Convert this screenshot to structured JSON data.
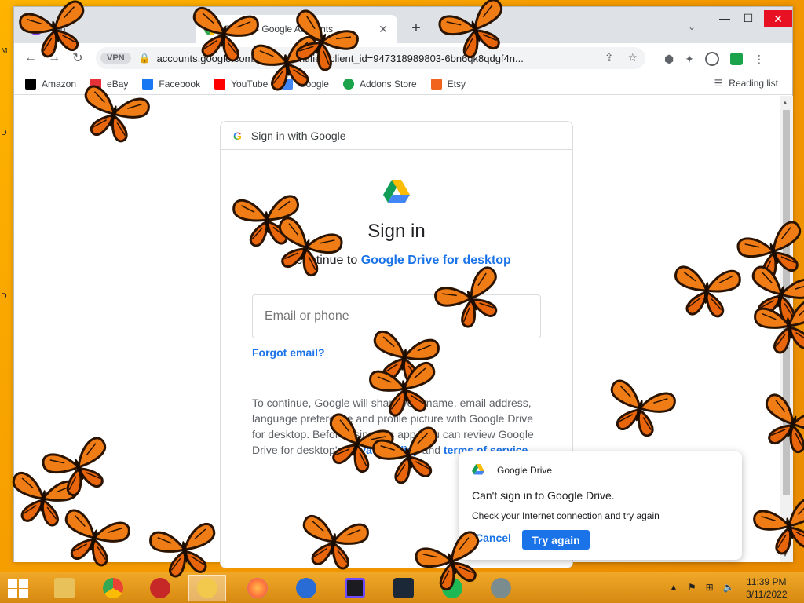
{
  "desktop": {
    "edge_labels": [
      "M",
      "D",
      "D"
    ]
  },
  "browser": {
    "tabs": [
      {
        "title": "Tab",
        "icon": "opera-icon"
      },
      {
        "title": "Sign in - Google Accounts",
        "icon": "google-icon"
      }
    ],
    "new_tab_label": "+",
    "tab_search_label": "⌄",
    "window_controls": {
      "minimize": "—",
      "maximize": "☐",
      "close": "✕"
    },
    "toolbar": {
      "back": "←",
      "forward": "→",
      "reload": "↻",
      "vpn_badge": "VPN",
      "url": "accounts.google.com/signin/identifier?client_id=947318989803-6bn6qk8qdgf4n..."
    },
    "bookmarks": [
      {
        "label": "Amazon",
        "icon": "amazon-icon",
        "color": "#000000"
      },
      {
        "label": "eBay",
        "icon": "ebay-icon",
        "color": "#e53238"
      },
      {
        "label": "Facebook",
        "icon": "facebook-icon",
        "color": "#1877f2"
      },
      {
        "label": "YouTube",
        "icon": "youtube-icon",
        "color": "#ff0000"
      },
      {
        "label": "Google",
        "icon": "google-icon",
        "color": "#4285f4"
      },
      {
        "label": "Addons Store",
        "icon": "addons-store-icon",
        "color": "#1aa34a"
      },
      {
        "label": "Etsy",
        "icon": "etsy-icon",
        "color": "#f1641e"
      }
    ],
    "reading_list": "Reading list"
  },
  "signin": {
    "header": "Sign in with Google",
    "title": "Sign in",
    "subtitle_prefix": "to continue to",
    "subtitle_app": "Google Drive for desktop",
    "email_placeholder": "Email or phone",
    "forgot_email": "Forgot email?",
    "consent_text": "To continue, Google will share your name, email address, language preference and profile picture with Google Drive for desktop. Before using this app, you can review Google Drive for desktop's",
    "privacy_link": "privacy policy",
    "and": "and",
    "terms_link": "terms of service"
  },
  "notification": {
    "app_name": "Google Drive",
    "title": "Can't sign in to Google Drive.",
    "body": "Check your Internet connection and try again",
    "cancel": "Cancel",
    "retry": "Try again"
  },
  "taskbar": {
    "apps": [
      {
        "name": "file-explorer-icon",
        "color": "#e8c15a",
        "active": false
      },
      {
        "name": "chrome-icon",
        "color": "#34a853",
        "active": false
      },
      {
        "name": "app-red-icon",
        "color": "#c62828",
        "active": false
      },
      {
        "name": "password-manager-icon",
        "color": "#f2c94c",
        "active": true
      },
      {
        "name": "firefox-icon",
        "color": "#ff7139",
        "active": false
      },
      {
        "name": "thunderbird-icon",
        "color": "#2a6cd6",
        "active": false
      },
      {
        "name": "protonvpn-icon",
        "color": "#6d4aff",
        "active": false
      },
      {
        "name": "steam-icon",
        "color": "#1b2838",
        "active": false
      },
      {
        "name": "spotify-icon",
        "color": "#1db954",
        "active": false
      },
      {
        "name": "network-app-icon",
        "color": "#7a8c8e",
        "active": false
      }
    ],
    "time": "11:39 PM",
    "date": "3/11/2022"
  }
}
